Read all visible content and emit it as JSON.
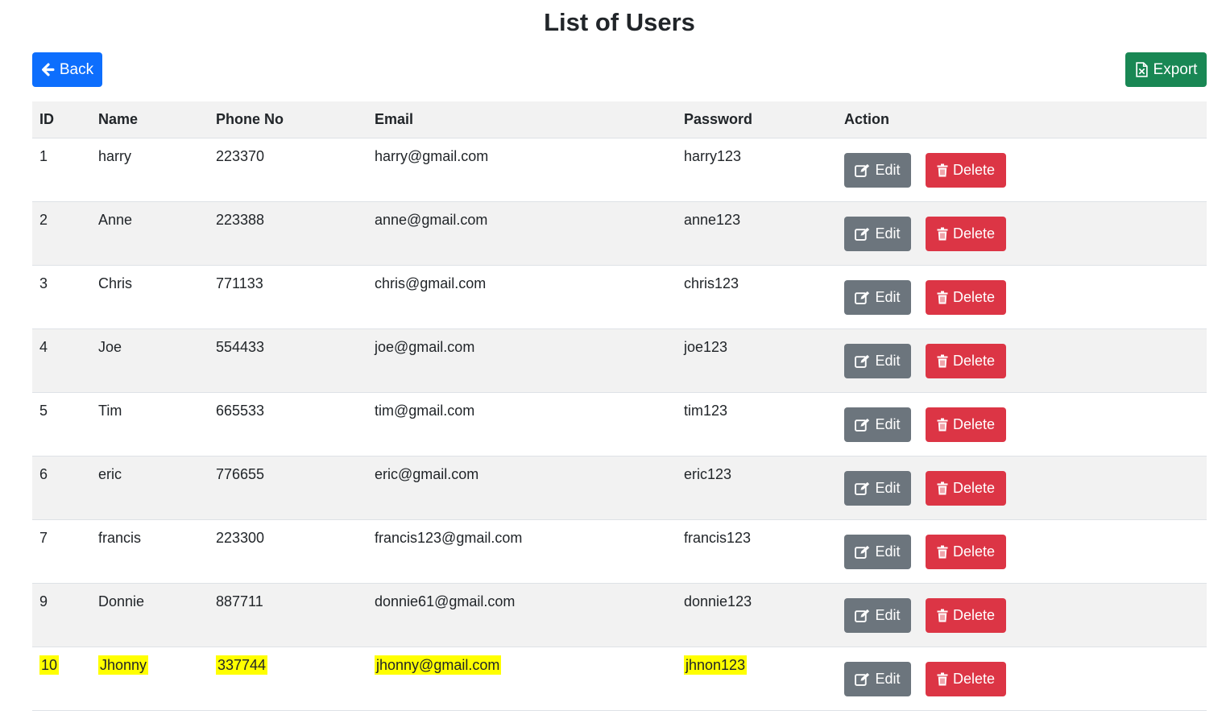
{
  "page": {
    "title": "List of Users"
  },
  "toolbar": {
    "back_label": "Back",
    "export_label": "Export",
    "back_icon": "arrow-left-icon",
    "export_icon": "file-excel-icon"
  },
  "colors": {
    "primary": "#0d6efd",
    "success": "#198754",
    "secondary": "#6c757d",
    "danger": "#dc3545",
    "highlight": "#ffff00"
  },
  "table": {
    "headers": [
      "ID",
      "Name",
      "Phone No",
      "Email",
      "Password",
      "Action"
    ],
    "edit_label": "Edit",
    "delete_label": "Delete",
    "rows": [
      {
        "id": "1",
        "name": "harry",
        "phone": "223370",
        "email": "harry@gmail.com",
        "password": "harry123"
      },
      {
        "id": "2",
        "name": "Anne",
        "phone": "223388",
        "email": "anne@gmail.com",
        "password": "anne123"
      },
      {
        "id": "3",
        "name": "Chris",
        "phone": "771133",
        "email": "chris@gmail.com",
        "password": "chris123"
      },
      {
        "id": "4",
        "name": "Joe",
        "phone": "554433",
        "email": "joe@gmail.com",
        "password": "joe123"
      },
      {
        "id": "5",
        "name": "Tim",
        "phone": "665533",
        "email": "tim@gmail.com",
        "password": "tim123"
      },
      {
        "id": "6",
        "name": "eric",
        "phone": "776655",
        "email": "eric@gmail.com",
        "password": "eric123"
      },
      {
        "id": "7",
        "name": "francis",
        "phone": "223300",
        "email": "francis123@gmail.com",
        "password": "francis123"
      },
      {
        "id": "9",
        "name": "Donnie",
        "phone": "887711",
        "email": "donnie61@gmail.com",
        "password": "donnie123"
      },
      {
        "id": "10",
        "name": "Jhonny",
        "phone": "337744",
        "email": "jhonny@gmail.com",
        "password": "jhnon123"
      }
    ]
  }
}
